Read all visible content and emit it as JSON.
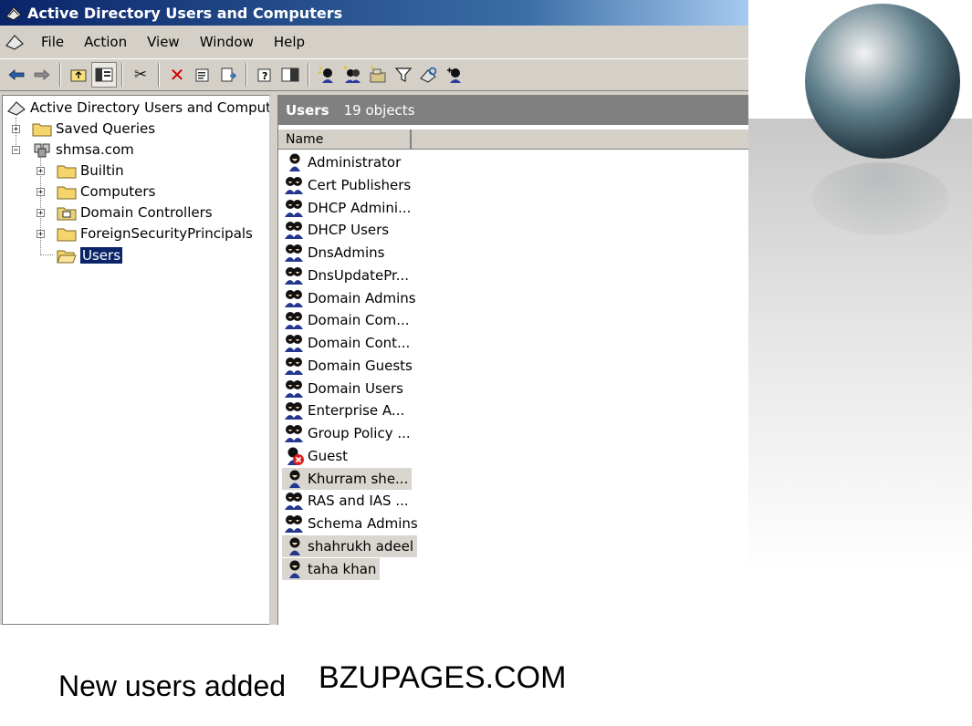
{
  "window": {
    "title": "Active Directory Users and Computers"
  },
  "menu": [
    "File",
    "Action",
    "View",
    "Window",
    "Help"
  ],
  "toolbar": {
    "icons": [
      "back-arrow-icon",
      "forward-arrow-icon",
      "up-folder-icon",
      "show-hide-tree-icon",
      "cut-icon",
      "delete-icon",
      "properties-icon",
      "export-list-icon",
      "help-icon",
      "console-tree-icon",
      "new-user-icon",
      "new-group-icon",
      "new-ou-icon",
      "filter-icon",
      "find-icon",
      "add-to-group-icon"
    ]
  },
  "tree": {
    "root": "Active Directory Users and Computer",
    "saved_queries": "Saved Queries",
    "domain": "shmsa.com",
    "children": [
      "Builtin",
      "Computers",
      "Domain Controllers",
      "ForeignSecurityPrincipals",
      "Users"
    ],
    "selected": "Users"
  },
  "list": {
    "title": "Users",
    "count": "19 objects",
    "column": "Name",
    "items": [
      {
        "name": "Administrator",
        "type": "user"
      },
      {
        "name": "Cert Publishers",
        "type": "group"
      },
      {
        "name": "DHCP Admini...",
        "type": "group"
      },
      {
        "name": "DHCP Users",
        "type": "group"
      },
      {
        "name": "DnsAdmins",
        "type": "group"
      },
      {
        "name": "DnsUpdatePr...",
        "type": "group"
      },
      {
        "name": "Domain Admins",
        "type": "group"
      },
      {
        "name": "Domain Com...",
        "type": "group"
      },
      {
        "name": "Domain Cont...",
        "type": "group"
      },
      {
        "name": "Domain Guests",
        "type": "group"
      },
      {
        "name": "Domain Users",
        "type": "group"
      },
      {
        "name": "Enterprise A...",
        "type": "group"
      },
      {
        "name": "Group Policy ...",
        "type": "group"
      },
      {
        "name": "Guest",
        "type": "disabled-user"
      },
      {
        "name": "Khurram she...",
        "type": "user",
        "highlighted": true
      },
      {
        "name": "RAS and IAS ...",
        "type": "group"
      },
      {
        "name": "Schema Admins",
        "type": "group"
      },
      {
        "name": "shahrukh adeel",
        "type": "user",
        "highlighted": true
      },
      {
        "name": "taha khan",
        "type": "user",
        "highlighted": true
      }
    ]
  },
  "caption": "New users added",
  "watermark": "BZUPAGES.COM"
}
